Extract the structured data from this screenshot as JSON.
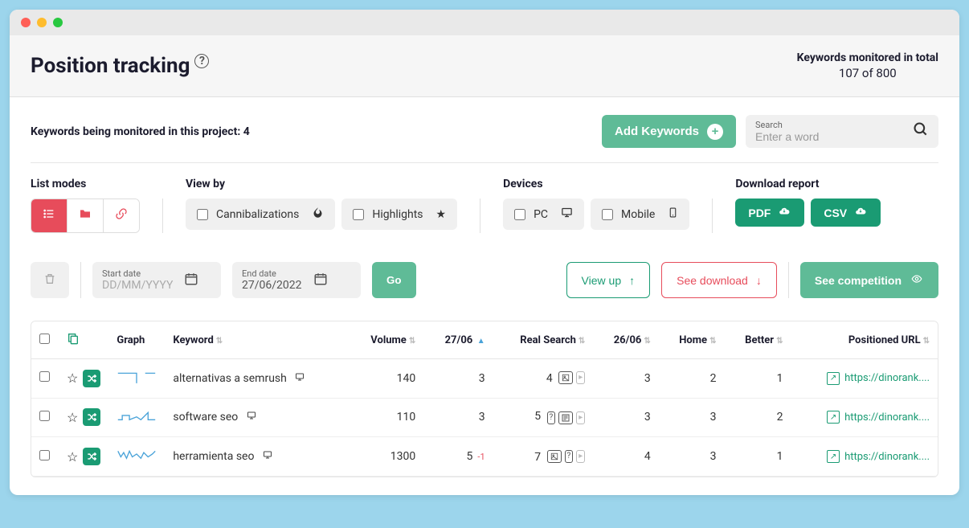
{
  "header": {
    "title": "Position tracking",
    "monitored_label": "Keywords monitored in total",
    "monitored_value": "107 of 800"
  },
  "row1": {
    "project_label": "Keywords being monitored in this project: 4",
    "add_button": "Add Keywords",
    "search_label": "Search",
    "search_placeholder": "Enter a word"
  },
  "filters": {
    "list_modes_label": "List modes",
    "view_by_label": "View by",
    "devices_label": "Devices",
    "download_label": "Download report",
    "cannibalizations": "Cannibalizations",
    "highlights": "Highlights",
    "pc": "PC",
    "mobile": "Mobile",
    "pdf": "PDF",
    "csv": "CSV"
  },
  "dates": {
    "start_label": "Start date",
    "start_placeholder": "DD/MM/YYYY",
    "end_label": "End date",
    "end_value": "27/06/2022",
    "go": "Go"
  },
  "actions": {
    "view_up": "View up",
    "see_download": "See download",
    "see_competition": "See competition"
  },
  "table": {
    "columns": {
      "graph": "Graph",
      "keyword": "Keyword",
      "volume": "Volume",
      "date": "27/06",
      "real_search": "Real Search",
      "prev_date": "26/06",
      "home": "Home",
      "better": "Better",
      "url": "Positioned URL"
    },
    "rows": [
      {
        "keyword": "alternativas a semrush",
        "volume": "140",
        "date_rank": "3",
        "real_search": "4",
        "delta": "",
        "prev_rank": "3",
        "home": "2",
        "better": "1",
        "url": "https://dinorank...."
      },
      {
        "keyword": "software seo",
        "volume": "110",
        "date_rank": "3",
        "real_search": "5",
        "delta": "",
        "prev_rank": "3",
        "home": "3",
        "better": "2",
        "url": "https://dinorank...."
      },
      {
        "keyword": "herramienta seo",
        "volume": "1300",
        "date_rank": "5",
        "real_search": "7",
        "delta": "-1",
        "prev_rank": "4",
        "home": "3",
        "better": "1",
        "url": "https://dinorank...."
      }
    ]
  }
}
